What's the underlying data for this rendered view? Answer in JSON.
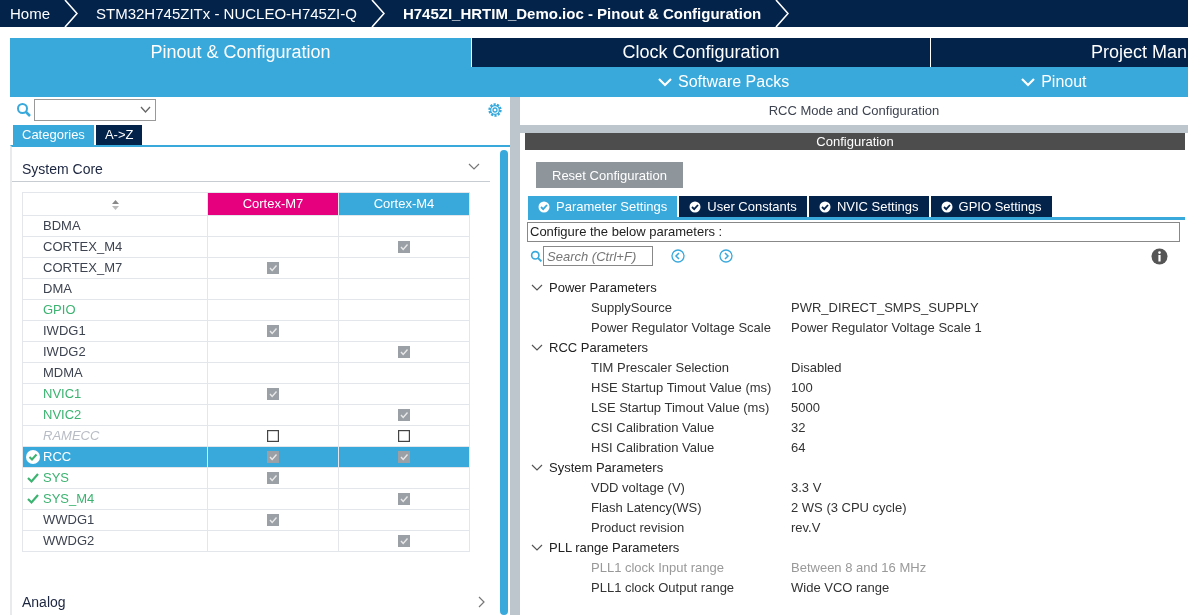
{
  "breadcrumb": [
    {
      "label": "Home",
      "current": false
    },
    {
      "label": "STM32H745ZITx  -  NUCLEO-H745ZI-Q",
      "current": false
    },
    {
      "label": "H745ZI_HRTIM_Demo.ioc - Pinout & Configuration",
      "current": true
    }
  ],
  "main_tabs": [
    {
      "label": "Pinout & Configuration",
      "selected": true
    },
    {
      "label": "Clock Configuration",
      "selected": false
    },
    {
      "label": "Project Man",
      "selected": false
    }
  ],
  "sub_menus": [
    {
      "label": "Software Packs"
    },
    {
      "label": "Pinout"
    }
  ],
  "left_panel": {
    "view_tabs": [
      {
        "label": "Categories",
        "selected": true
      },
      {
        "label": "A->Z",
        "selected": false
      }
    ],
    "categories": [
      {
        "title": "System Core",
        "expanded": true,
        "columns": [
          {
            "label": "Cortex-M7",
            "color": "#e6007e"
          },
          {
            "label": "Cortex-M4",
            "color": "#39a9dc"
          }
        ],
        "rows": [
          {
            "name": "BDMA",
            "configured": false,
            "disabled": false,
            "configured_mark": false,
            "selected": false,
            "cores": [
              {
                "available": false
              },
              {
                "available": false
              }
            ]
          },
          {
            "name": "CORTEX_M4",
            "configured": false,
            "disabled": false,
            "configured_mark": false,
            "selected": false,
            "cores": [
              {
                "available": false
              },
              {
                "available": true,
                "checked": true
              }
            ]
          },
          {
            "name": "CORTEX_M7",
            "configured": false,
            "disabled": false,
            "configured_mark": false,
            "selected": false,
            "cores": [
              {
                "available": true,
                "checked": true
              },
              {
                "available": false
              }
            ]
          },
          {
            "name": "DMA",
            "configured": false,
            "disabled": false,
            "configured_mark": false,
            "selected": false,
            "cores": [
              {
                "available": false
              },
              {
                "available": false
              }
            ]
          },
          {
            "name": "GPIO",
            "configured": true,
            "disabled": false,
            "configured_mark": false,
            "selected": false,
            "cores": [
              {
                "available": false
              },
              {
                "available": false
              }
            ]
          },
          {
            "name": "IWDG1",
            "configured": false,
            "disabled": false,
            "configured_mark": false,
            "selected": false,
            "cores": [
              {
                "available": true,
                "checked": true
              },
              {
                "available": false
              }
            ]
          },
          {
            "name": "IWDG2",
            "configured": false,
            "disabled": false,
            "configured_mark": false,
            "selected": false,
            "cores": [
              {
                "available": false
              },
              {
                "available": true,
                "checked": true
              }
            ]
          },
          {
            "name": "MDMA",
            "configured": false,
            "disabled": false,
            "configured_mark": false,
            "selected": false,
            "cores": [
              {
                "available": false
              },
              {
                "available": false
              }
            ]
          },
          {
            "name": "NVIC1",
            "configured": true,
            "disabled": false,
            "configured_mark": false,
            "selected": false,
            "cores": [
              {
                "available": true,
                "checked": true
              },
              {
                "available": false
              }
            ]
          },
          {
            "name": "NVIC2",
            "configured": true,
            "disabled": false,
            "configured_mark": false,
            "selected": false,
            "cores": [
              {
                "available": false
              },
              {
                "available": true,
                "checked": true
              }
            ]
          },
          {
            "name": "RAMECC",
            "configured": false,
            "disabled": true,
            "configured_mark": false,
            "selected": false,
            "cores": [
              {
                "available": true,
                "checked": false
              },
              {
                "available": true,
                "checked": false
              }
            ]
          },
          {
            "name": "RCC",
            "configured": false,
            "disabled": false,
            "configured_mark": true,
            "selected": true,
            "cores": [
              {
                "available": true,
                "checked": true
              },
              {
                "available": true,
                "checked": true
              }
            ]
          },
          {
            "name": "SYS",
            "configured": true,
            "disabled": false,
            "configured_mark": true,
            "selected": false,
            "cores": [
              {
                "available": true,
                "checked": true
              },
              {
                "available": false
              }
            ]
          },
          {
            "name": "SYS_M4",
            "configured": true,
            "disabled": false,
            "configured_mark": true,
            "selected": false,
            "cores": [
              {
                "available": false
              },
              {
                "available": true,
                "checked": true
              }
            ]
          },
          {
            "name": "WWDG1",
            "configured": false,
            "disabled": false,
            "configured_mark": false,
            "selected": false,
            "cores": [
              {
                "available": true,
                "checked": true
              },
              {
                "available": false
              }
            ]
          },
          {
            "name": "WWDG2",
            "configured": false,
            "disabled": false,
            "configured_mark": false,
            "selected": false,
            "cores": [
              {
                "available": false
              },
              {
                "available": true,
                "checked": true
              }
            ]
          }
        ]
      },
      {
        "title": "Analog",
        "expanded": false
      }
    ]
  },
  "right_panel": {
    "title": "RCC Mode and Configuration",
    "section_title": "Configuration",
    "reset_button": "Reset Configuration",
    "tabs": [
      {
        "label": "Parameter Settings",
        "selected": true
      },
      {
        "label": "User Constants",
        "selected": false
      },
      {
        "label": "NVIC Settings",
        "selected": false
      },
      {
        "label": "GPIO Settings",
        "selected": false
      }
    ],
    "description": "Configure the below parameters :",
    "search": {
      "placeholder": "Search (Ctrl+F)"
    },
    "groups": [
      {
        "name": "Power Parameters",
        "expanded": true,
        "params": [
          {
            "name": "SupplySource",
            "value": "PWR_DIRECT_SMPS_SUPPLY",
            "disabled": false
          },
          {
            "name": "Power Regulator Voltage Scale",
            "value": "Power Regulator Voltage Scale 1",
            "disabled": false
          }
        ]
      },
      {
        "name": "RCC Parameters",
        "expanded": true,
        "params": [
          {
            "name": "TIM Prescaler Selection",
            "value": "Disabled",
            "disabled": false
          },
          {
            "name": "HSE Startup Timout Value (ms)",
            "value": "100",
            "disabled": false
          },
          {
            "name": "LSE Startup Timout Value (ms)",
            "value": "5000",
            "disabled": false
          },
          {
            "name": "CSI Calibration Value",
            "value": "32",
            "disabled": false
          },
          {
            "name": "HSI Calibration Value",
            "value": "64",
            "disabled": false
          }
        ]
      },
      {
        "name": "System Parameters",
        "expanded": true,
        "params": [
          {
            "name": "VDD voltage (V)",
            "value": "3.3 V",
            "disabled": false
          },
          {
            "name": "Flash Latency(WS)",
            "value": "2 WS (3 CPU cycle)",
            "disabled": false
          },
          {
            "name": "Product revision",
            "value": "rev.V",
            "disabled": false
          }
        ]
      },
      {
        "name": "PLL range Parameters",
        "expanded": true,
        "params": [
          {
            "name": "PLL1 clock Input range",
            "value": "Between 8 and 16 MHz",
            "disabled": true
          },
          {
            "name": "PLL1 clock Output range",
            "value": "Wide VCO range",
            "disabled": false
          }
        ]
      }
    ]
  }
}
